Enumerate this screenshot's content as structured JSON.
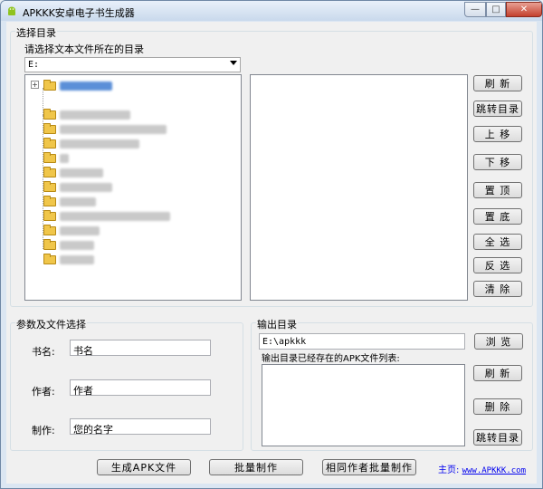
{
  "window": {
    "title": "APKKK安卓电子书生成器",
    "controls": {
      "minimize": "—",
      "maximize": "□",
      "close": "✕"
    }
  },
  "select_dir_group": {
    "title": "选择目录",
    "prompt": "请选择文本文件所在的目录",
    "drive": "E:",
    "tree": {
      "expander": "+",
      "items": 12
    },
    "buttons": {
      "refresh": "刷 新",
      "goto_dir": "跳转目录",
      "move_up": "上 移",
      "move_down": "下 移",
      "to_top": "置 顶",
      "to_bottom": "置 底",
      "select_all": "全 选",
      "invert": "反 选",
      "clear": "清 除"
    }
  },
  "params_group": {
    "title": "参数及文件选择",
    "book_label": "书名:",
    "book_value": "书名",
    "author_label": "作者:",
    "author_value": "作者",
    "maker_label": "制作:",
    "maker_value": "您的名字"
  },
  "output_group": {
    "title": "输出目录",
    "path": "E:\\apkkk",
    "browse": "浏 览",
    "list_label": "输出目录已经存在的APK文件列表:",
    "refresh": "刷 新",
    "delete": "删 除",
    "goto_dir": "跳转目录"
  },
  "bottom": {
    "generate": "生成APK文件",
    "batch": "批量制作",
    "same_author_batch": "相同作者批量制作",
    "homepage_label": "主页:",
    "homepage_url": "www.APKKK.com"
  },
  "colors": {
    "accent": "#5b8fd8",
    "window_border": "#6f88a6",
    "close": "#c4402e"
  }
}
